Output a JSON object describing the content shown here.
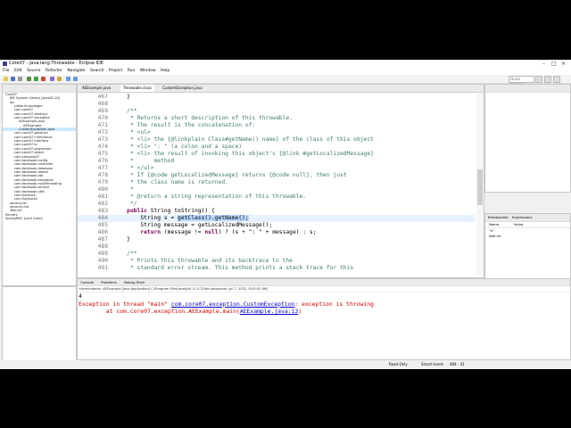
{
  "window": {
    "title": "Core07 - java.lang.Throwable - Eclipse IDE"
  },
  "menu": [
    "File",
    "Edit",
    "Source",
    "Refactor",
    "Navigate",
    "Search",
    "Project",
    "Run",
    "Window",
    "Help"
  ],
  "toolbar": {
    "quick_access": "Quick Access"
  },
  "package_explorer": {
    "items": [
      {
        "label": "Core07",
        "level": 0
      },
      {
        "label": "JRE System Library [JavaSE-10]",
        "level": 1
      },
      {
        "label": "src",
        "level": 1
      },
      {
        "label": "(default package)",
        "level": 2
      },
      {
        "label": "com.core07",
        "level": 2
      },
      {
        "label": "com.core07.abstract",
        "level": 2
      },
      {
        "label": "com.core07.exception",
        "level": 2
      },
      {
        "label": "AEExample.java",
        "level": 3
      },
      {
        "label": "AEExample",
        "level": 4
      },
      {
        "label": "CustomException.java",
        "level": 3,
        "selected": true
      },
      {
        "label": "com.core07.generics",
        "level": 2
      },
      {
        "label": "com.core07.inheritance",
        "level": 2
      },
      {
        "label": "com.core07.interface",
        "level": 2
      },
      {
        "label": "com.core07.io",
        "level": 2
      },
      {
        "label": "com.core07.polymorph",
        "level": 2
      },
      {
        "label": "com.core07.object",
        "level": 2
      },
      {
        "label": "com.coreproj07",
        "level": 2
      },
      {
        "label": "com.facebook.config",
        "level": 2
      },
      {
        "label": "com.facebook.controller",
        "level": 2
      },
      {
        "label": "com.facebook.database",
        "level": 2
      },
      {
        "label": "com.facebook.dream",
        "level": 2
      },
      {
        "label": "com.facebook.dto",
        "level": 2
      },
      {
        "label": "com.facebook.exception",
        "level": 2
      },
      {
        "label": "com.facebook.multithreading",
        "level": 2
      },
      {
        "label": "com.facebook.service",
        "level": 2
      },
      {
        "label": "com.facebook.utils",
        "level": 2
      },
      {
        "label": "com.fullstack",
        "level": 2
      },
      {
        "label": "com.fullstack2",
        "level": 2
      },
      {
        "label": "second.txt",
        "level": 1
      },
      {
        "label": "second1.txt",
        "level": 1
      },
      {
        "label": "Test.txt",
        "level": 1
      },
      {
        "label": "Servers",
        "level": 0
      },
      {
        "label": "SpringMVC [core main]",
        "level": 0
      }
    ]
  },
  "editor": {
    "tabs": [
      "AEExample.java",
      "Throwable.class",
      "CustomException.java"
    ],
    "active_tab": 1,
    "lines": [
      {
        "n": "467",
        "text": "    }"
      },
      {
        "n": "468",
        "text": ""
      },
      {
        "n": "469",
        "text": "    /**"
      },
      {
        "n": "470",
        "text": "     * Returns a short description of this throwable."
      },
      {
        "n": "471",
        "text": "     * The result is the concatenation of:"
      },
      {
        "n": "472",
        "text": "     * <ul>"
      },
      {
        "n": "473",
        "text": "     * <li> the {@linkplain Class#getName() name} of the class of this object"
      },
      {
        "n": "474",
        "text": "     * <li> \": \" (a colon and a space)"
      },
      {
        "n": "475",
        "text": "     * <li> the result of invoking this object's {@link #getLocalizedMessage}"
      },
      {
        "n": "476",
        "text": "     *      method"
      },
      {
        "n": "477",
        "text": "     * </ul>"
      },
      {
        "n": "478",
        "text": "     * If {@code getLocalizedMessage} returns {@code null}, then just"
      },
      {
        "n": "479",
        "text": "     * the class name is returned."
      },
      {
        "n": "480",
        "text": "     *"
      },
      {
        "n": "481",
        "text": "     * @return a string representation of this throwable."
      },
      {
        "n": "482",
        "text": "     */"
      },
      {
        "n": "483",
        "text": "    public String toString() {"
      },
      {
        "n": "484",
        "text": "        String s = getClass().getName();"
      },
      {
        "n": "485",
        "text": "        String message = getLocalizedMessage();"
      },
      {
        "n": "486",
        "text": "        return (message != null) ? (s + \": \" + message) : s;"
      },
      {
        "n": "487",
        "text": "    }"
      },
      {
        "n": "488",
        "text": ""
      },
      {
        "n": "489",
        "text": "    /**"
      },
      {
        "n": "490",
        "text": "     * Prints this throwable and its backtrace to the"
      },
      {
        "n": "491",
        "text": "     * standard error stream. This method prints a stack trace for this"
      }
    ]
  },
  "right_panel": {
    "expr_tabs": [
      "Breakpoints",
      "Expressions"
    ],
    "col_name": "Name",
    "col_value": "Value",
    "rows": [
      "\"s\"",
      "Add ne"
    ]
  },
  "console": {
    "tabs": [
      "Console",
      "Problems",
      "Debug Shell"
    ],
    "terminated": "<terminated> AEExample [Java Application] C:\\Program Files\\Java\\jdk-11.0.12\\bin\\javaw.exe (Jul 7, 2022, 8:43:02 AM)",
    "line1": "4",
    "line2_prefix": "Exception in thread \"main\" ",
    "line2_link": "com.core07.exception.CustomException",
    "line2_suffix": ": exception is throwing",
    "line3_prefix": "        at com.core07.exception.AEExample.main(",
    "line3_link": "AEExample.java:13",
    "line3_suffix": ")"
  },
  "status": {
    "mode": "Read-Only",
    "insert": "Smart Insert",
    "pos": "484 : 41"
  },
  "colors": {
    "comment": "#3f7f5f",
    "keyword": "#7f0055",
    "error": "#dd0000",
    "link": "#0000cc"
  }
}
